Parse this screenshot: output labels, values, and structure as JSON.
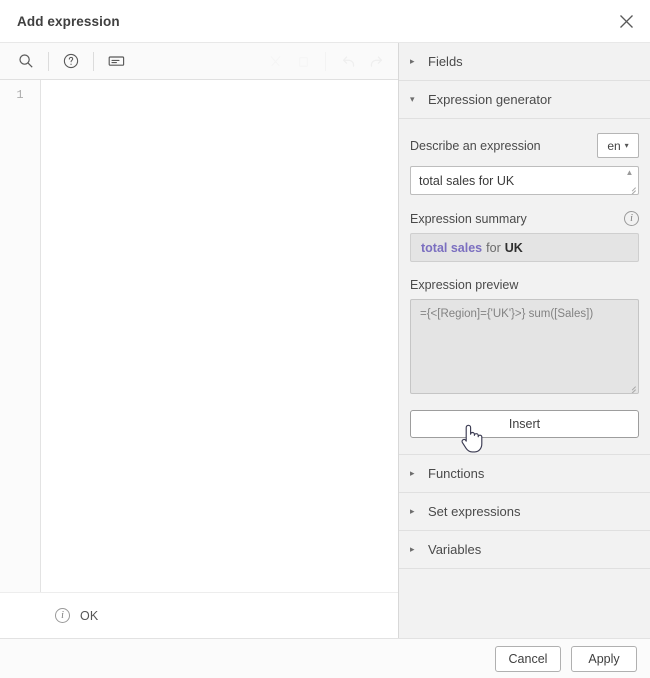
{
  "dialog": {
    "title": "Add expression",
    "close_icon": "close-icon"
  },
  "editor": {
    "toolbar": {
      "search_icon": "search-icon",
      "help_icon": "help-circle-icon",
      "comment_icon": "comment-box-icon",
      "undo_icon": "undo-arrow-icon",
      "redo_icon": "redo-arrow-icon"
    },
    "line_numbers": [
      "1"
    ],
    "content": "",
    "status": {
      "icon": "info-circle-icon",
      "text": "OK"
    }
  },
  "panel": {
    "sections": [
      {
        "label": "Fields",
        "expanded": false,
        "caret": "▸"
      },
      {
        "label": "Expression generator",
        "expanded": true,
        "caret": "▾"
      },
      {
        "label": "Functions",
        "expanded": false,
        "caret": "▸"
      },
      {
        "label": "Set expressions",
        "expanded": false,
        "caret": "▸"
      },
      {
        "label": "Variables",
        "expanded": false,
        "caret": "▸"
      }
    ],
    "generator": {
      "describe_label": "Describe an expression",
      "language": "en",
      "language_chevron": "▾",
      "describe_value": "total sales for UK",
      "describe_placeholder": "Describe an expression",
      "summary_label": "Expression summary",
      "summary_info_icon": "info-circle-icon",
      "summary_metric": "total sales",
      "summary_connector": "for",
      "summary_dimension": "UK",
      "preview_label": "Expression preview",
      "preview_value": "={<[Region]={'UK'}>} sum([Sales])",
      "insert_label": "Insert"
    }
  },
  "footer": {
    "cancel_label": "Cancel",
    "apply_label": "Apply"
  },
  "colors": {
    "accent_purple": "#7b6fc0",
    "panel_bg": "#f2f2f2",
    "box_bg": "#e4e4e4",
    "text": "#4a4a4a"
  },
  "cursor": {
    "type": "pointing-hand"
  }
}
